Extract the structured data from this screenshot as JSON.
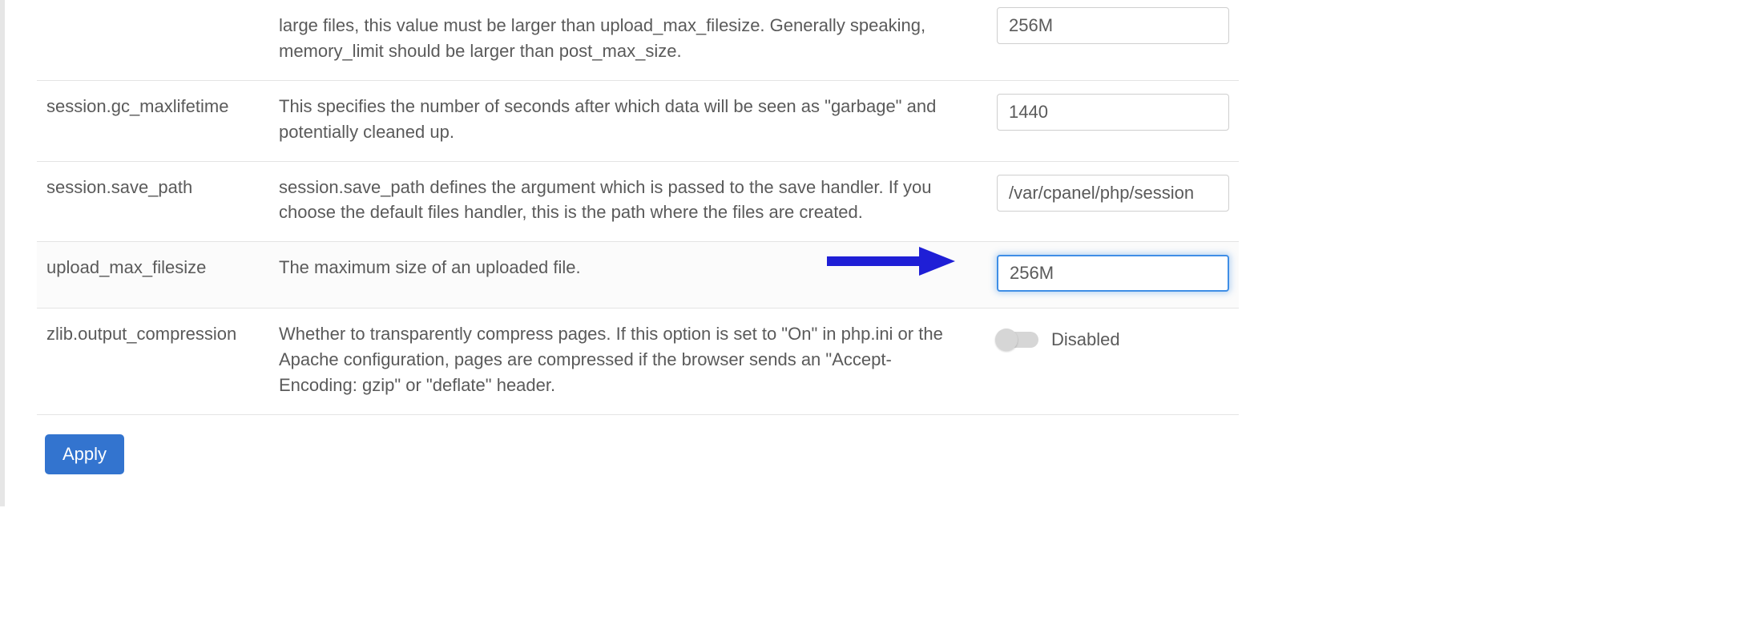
{
  "rows": [
    {
      "name": "",
      "description": "large files, this value must be larger than upload_max_filesize. Generally speaking, memory_limit should be larger than post_max_size.",
      "control": {
        "type": "text",
        "value": "256M",
        "focused": false,
        "truncated": true
      }
    },
    {
      "name": "session.gc_maxlifetime",
      "description": "This specifies the number of seconds after which data will be seen as \"garbage\" and potentially cleaned up.",
      "control": {
        "type": "text",
        "value": "1440",
        "focused": false
      }
    },
    {
      "name": "session.save_path",
      "description": "session.save_path defines the argument which is passed to the save handler. If you choose the default files handler, this is the path where the files are created.",
      "control": {
        "type": "text",
        "value": "/var/cpanel/php/session",
        "focused": false
      }
    },
    {
      "name": "upload_max_filesize",
      "description": "The maximum size of an uploaded file.",
      "control": {
        "type": "text",
        "value": "256M",
        "focused": true
      },
      "arrow": true
    },
    {
      "name": "zlib.output_compression",
      "description": "Whether to transparently compress pages. If this option is set to \"On\" in php.ini or the Apache configuration, pages are compressed if the browser sends an \"Accept-Encoding: gzip\" or \"deflate\" header.",
      "control": {
        "type": "toggle",
        "enabled": false,
        "label": "Disabled"
      }
    }
  ],
  "buttons": {
    "apply": "Apply"
  },
  "annotation": {
    "arrow_color": "#1f1fd6"
  }
}
